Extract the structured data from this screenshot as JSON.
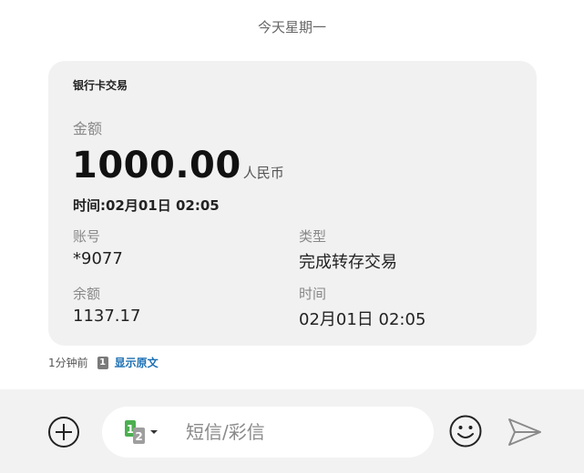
{
  "day_header": "今天星期一",
  "card": {
    "title": "银行卡交易",
    "amount_label": "金额",
    "amount_value": "1000.00",
    "amount_currency": "人民币",
    "time_line": "时间:02月01日 02:05",
    "fields": [
      {
        "label": "账号",
        "value": "*9077"
      },
      {
        "label": "类型",
        "value": "完成转存交易"
      },
      {
        "label": "余额",
        "value": "1137.17"
      },
      {
        "label": "时间",
        "value": "02月01日 02:05"
      }
    ]
  },
  "meta": {
    "time_ago": "1分钟前",
    "sim_number": "1",
    "show_original": "显示原文"
  },
  "composer": {
    "placeholder": "短信/彩信",
    "sim1": "1",
    "sim2": "2",
    "icons": [
      "add-icon",
      "sim-select-icon",
      "emoji-icon",
      "send-icon"
    ],
    "colors": {
      "sim1": "#4caf50",
      "sim2": "#9e9e9e",
      "link": "#1a6fb4"
    }
  }
}
